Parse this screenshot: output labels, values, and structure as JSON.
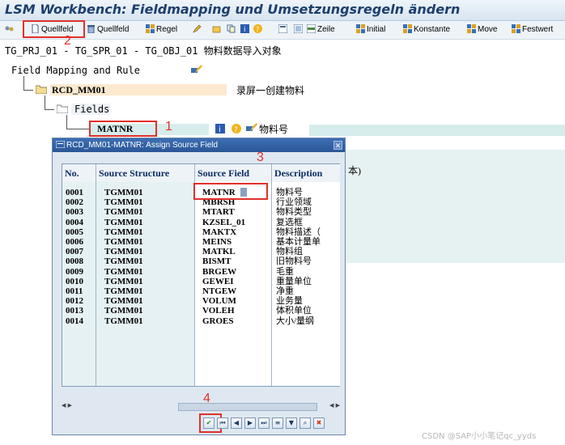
{
  "window": {
    "title": "LSM Workbench: Fieldmapping und Umsetzungsregeln ändern"
  },
  "toolbar": {
    "items": [
      {
        "label": "Quellfeld",
        "icon": "document-icon"
      },
      {
        "label": "Quellfeld",
        "icon": "trash-icon"
      },
      {
        "label": "Regel",
        "icon": "rule-icon"
      },
      {
        "label": "Zeile",
        "icon": "row-icon"
      },
      {
        "label": "Initial",
        "icon": "rule-icon"
      },
      {
        "label": "Konstante",
        "icon": "rule-icon"
      },
      {
        "label": "Move",
        "icon": "rule-icon"
      },
      {
        "label": "Festwert",
        "icon": "rule-icon"
      }
    ]
  },
  "breadcrumb": "TG_PRJ_01 - TG_SPR_01 - TG_OBJ_01 物料数据导入对象",
  "tree": {
    "root": "Field Mapping and Rule",
    "structure": "RCD_MM01",
    "structure_desc": "录屏一创建物料",
    "fields_node": "Fields",
    "field": "MATNR",
    "field_desc": "物料号",
    "overflow_text": "本)"
  },
  "annotations": [
    "1",
    "2",
    "3",
    "4"
  ],
  "dialog": {
    "title": "RCD_MM01-MATNR: Assign Source Field",
    "columns": [
      "No.",
      "Source Structure",
      "Source Field",
      "Description"
    ],
    "rows": [
      {
        "no": "0001",
        "structure": "TGMM01",
        "field": "MATNR",
        "desc": "物料号"
      },
      {
        "no": "0002",
        "structure": "TGMM01",
        "field": "MBRSH",
        "desc": "行业领域"
      },
      {
        "no": "0003",
        "structure": "TGMM01",
        "field": "MTART",
        "desc": "物料类型"
      },
      {
        "no": "0004",
        "structure": "TGMM01",
        "field": "KZSEL_01",
        "desc": "复选框"
      },
      {
        "no": "0005",
        "structure": "TGMM01",
        "field": "MAKTX",
        "desc": "物料描述（"
      },
      {
        "no": "0006",
        "structure": "TGMM01",
        "field": "MEINS",
        "desc": "基本计量单"
      },
      {
        "no": "0007",
        "structure": "TGMM01",
        "field": "MATKL",
        "desc": "物料组"
      },
      {
        "no": "0008",
        "structure": "TGMM01",
        "field": "BISMT",
        "desc": "旧物料号"
      },
      {
        "no": "0009",
        "structure": "TGMM01",
        "field": "BRGEW",
        "desc": "毛重"
      },
      {
        "no": "0010",
        "structure": "TGMM01",
        "field": "GEWEI",
        "desc": "重量单位"
      },
      {
        "no": "0011",
        "structure": "TGMM01",
        "field": "NTGEW",
        "desc": "净重"
      },
      {
        "no": "0012",
        "structure": "TGMM01",
        "field": "VOLUM",
        "desc": "业务量"
      },
      {
        "no": "0013",
        "structure": "TGMM01",
        "field": "VOLEH",
        "desc": "体积单位"
      },
      {
        "no": "0014",
        "structure": "TGMM01",
        "field": "GROES",
        "desc": "大小/量纲"
      }
    ],
    "buttons": [
      "confirm-icon",
      "first-page-icon",
      "prev-page-icon",
      "next-page-icon",
      "last-page-icon",
      "sort-icon",
      "filter-icon",
      "find-icon",
      "cancel-icon"
    ]
  },
  "watermark": "CSDN @SAP小小笔记qc_yyds",
  "colors": {
    "annotation": "#e0312b",
    "title": "#1d3f6e",
    "teal": "#d7ecec",
    "structure_fill": "#fde9cf"
  }
}
